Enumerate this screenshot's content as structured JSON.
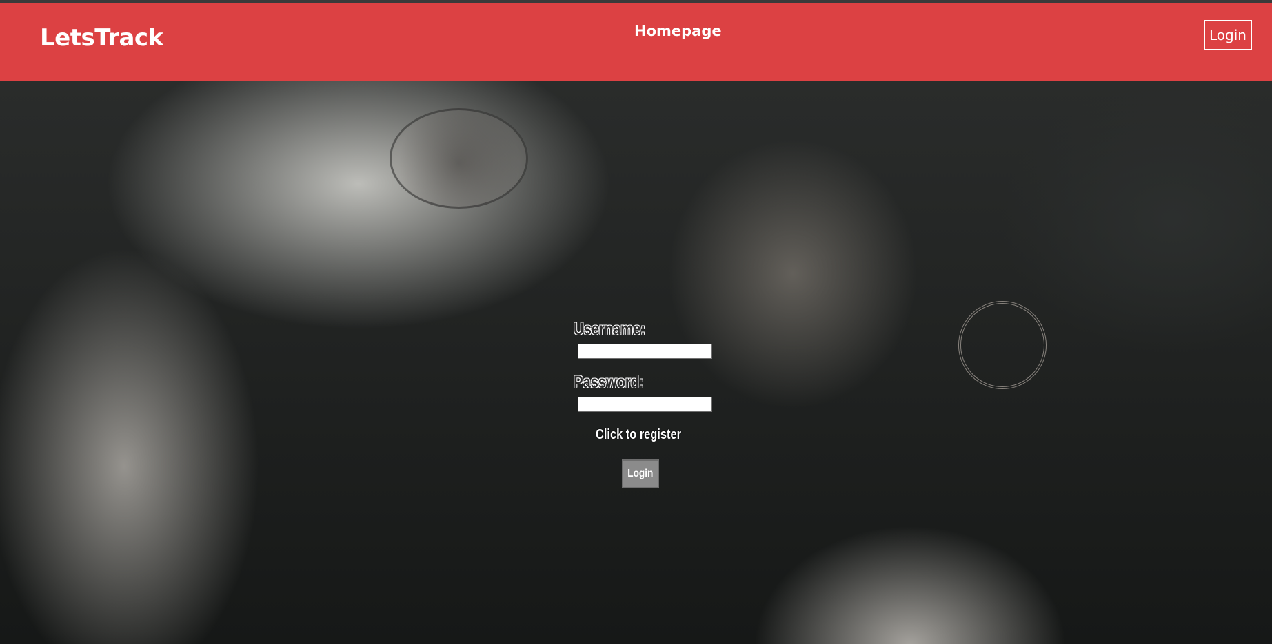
{
  "navbar": {
    "brand": "LetsTrack",
    "home_link": "Homepage",
    "login_button": "Login",
    "background_color": "#dc4143"
  },
  "login_form": {
    "username_label": "Username:",
    "username_value": "",
    "password_label": "Password:",
    "password_value": "",
    "register_link": "Click to register",
    "submit_label": "Login"
  }
}
